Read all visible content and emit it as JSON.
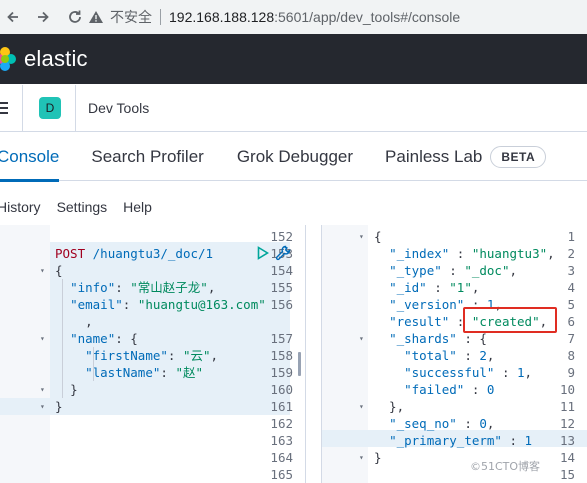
{
  "browser": {
    "insecure_label": "不安全",
    "url_host": "192.168.188.128",
    "url_rest": ":5601/app/dev_tools#/console"
  },
  "header": {
    "brand": "elastic"
  },
  "app": {
    "space_initial": "D",
    "title": "Dev Tools"
  },
  "tabs": [
    {
      "label": "Console",
      "active": true
    },
    {
      "label": "Search Profiler",
      "active": false
    },
    {
      "label": "Grok Debugger",
      "active": false
    },
    {
      "label": "Painless Lab",
      "active": false,
      "badge": "BETA"
    }
  ],
  "subnav": {
    "history": "History",
    "settings": "Settings",
    "help": "Help"
  },
  "request_editor": {
    "lines": [
      {
        "n": "152",
        "fold": false
      },
      {
        "n": "153",
        "fold": false
      },
      {
        "n": "154",
        "fold": true
      },
      {
        "n": "155",
        "fold": false
      },
      {
        "n": "156",
        "fold": false
      },
      {
        "n": "",
        "fold": false
      },
      {
        "n": "157",
        "fold": true
      },
      {
        "n": "158",
        "fold": false
      },
      {
        "n": "159",
        "fold": false
      },
      {
        "n": "160",
        "fold": true
      },
      {
        "n": "161",
        "fold": true
      },
      {
        "n": "162",
        "fold": false
      },
      {
        "n": "163",
        "fold": false
      },
      {
        "n": "164",
        "fold": false
      },
      {
        "n": "165",
        "fold": false
      }
    ],
    "method": "POST",
    "url": "/huangtu3/_doc/1",
    "open_brace": "{",
    "info_key": "\"info\"",
    "info_value": "\"常山赵子龙\"",
    "email_key": "\"email\"",
    "email_value": "\"huangtu@163.com\"",
    "wrap_comma": ",",
    "name_key": "\"name\"",
    "first_key": "\"firstName\"",
    "first_value": "\"云\"",
    "last_key": "\"lastName\"",
    "last_value": "\"赵\"",
    "close_inner": "}",
    "close_outer": "}"
  },
  "response_editor": {
    "lines": [
      {
        "n": "1",
        "fold": true,
        "text": "{"
      },
      {
        "n": "2",
        "fold": false,
        "text": "  \"_index\" : \"huangtu3\","
      },
      {
        "n": "3",
        "fold": false,
        "text": "  \"_type\" : \"_doc\","
      },
      {
        "n": "4",
        "fold": false,
        "text": "  \"_id\" : \"1\","
      },
      {
        "n": "5",
        "fold": false,
        "text": "  \"_version\" : 1,"
      },
      {
        "n": "6",
        "fold": false,
        "text": "  \"result\" : \"created\","
      },
      {
        "n": "7",
        "fold": true,
        "text": "  \"_shards\" : {"
      },
      {
        "n": "8",
        "fold": false,
        "text": "    \"total\" : 2,"
      },
      {
        "n": "9",
        "fold": false,
        "text": "    \"successful\" : 1,"
      },
      {
        "n": "10",
        "fold": false,
        "text": "    \"failed\" : 0"
      },
      {
        "n": "11",
        "fold": true,
        "text": "  },"
      },
      {
        "n": "12",
        "fold": false,
        "text": "  \"_seq_no\" : 0,"
      },
      {
        "n": "13",
        "fold": false,
        "text": "  \"_primary_term\" : 1"
      },
      {
        "n": "14",
        "fold": true,
        "text": "}"
      },
      {
        "n": "15",
        "fold": false,
        "text": ""
      }
    ]
  },
  "watermark": "©51CTO博客",
  "colors": {
    "accent": "#006bb8",
    "header_bg": "#25282f",
    "badge": "#20c3b6",
    "highlight": "#e02d22"
  }
}
